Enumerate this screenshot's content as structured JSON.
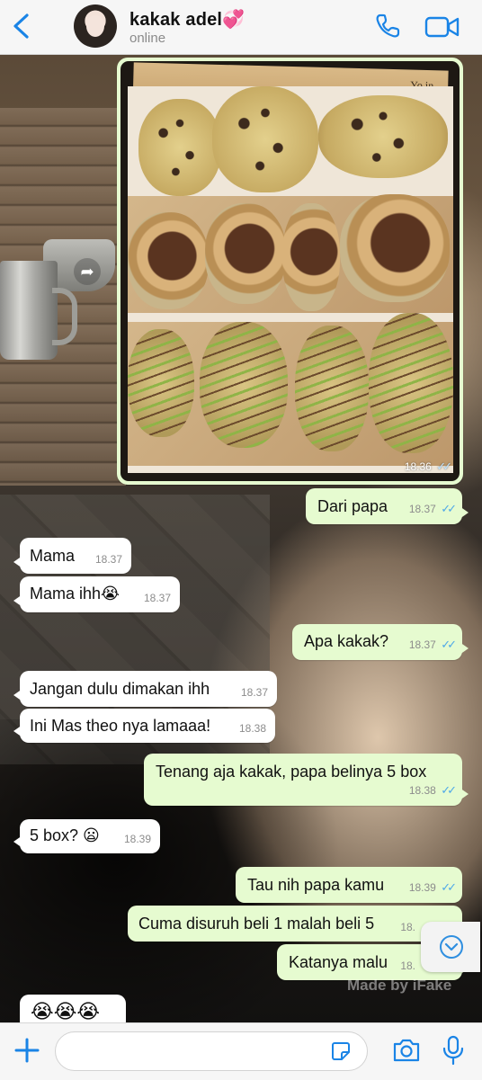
{
  "header": {
    "contact_name": "kakak adel💞",
    "status": "online",
    "back_icon": "chevron-left-icon",
    "call_icon": "phone-icon",
    "video_icon": "video-camera-icon",
    "accent_color": "#1a84e6"
  },
  "photo_message": {
    "time": "18.36",
    "newspaper_text": "Yo in"
  },
  "messages": [
    {
      "text": "Dari papa",
      "time": "18.37",
      "direction": "outgoing"
    },
    {
      "text": "Mama",
      "time": "18.37",
      "direction": "incoming"
    },
    {
      "text": "Mama ihh😭",
      "time": "18.37",
      "direction": "incoming"
    },
    {
      "text": "Apa kakak?",
      "time": "18.37",
      "direction": "outgoing"
    },
    {
      "text": "Jangan dulu dimakan ihh",
      "time": "18.37",
      "direction": "incoming"
    },
    {
      "text": "Ini Mas theo nya lamaaa!",
      "time": "18.38",
      "direction": "incoming"
    },
    {
      "text": "Tenang aja kakak, papa belinya 5 box",
      "time": "18.38",
      "direction": "outgoing"
    },
    {
      "text": "5 box? 😦",
      "time": "18.39",
      "direction": "incoming"
    },
    {
      "text": "Tau nih papa kamu",
      "time": "18.39",
      "direction": "outgoing"
    },
    {
      "text": "Cuma disuruh beli 1 malah beli 5",
      "time": "18.",
      "direction": "outgoing"
    },
    {
      "text": "Katanya malu",
      "time": "18.",
      "direction": "outgoing"
    },
    {
      "text": "😭😭😭",
      "time": "",
      "direction": "incoming"
    }
  ],
  "watermark": "Made by iFake",
  "input_bar": {
    "plus_icon": "plus-icon",
    "sticker_icon": "sticker-icon",
    "camera_icon": "camera-icon",
    "mic_icon": "microphone-icon",
    "message_value": ""
  },
  "colors": {
    "outgoing_bubble": "#e6fbd0",
    "incoming_bubble": "#ffffff",
    "read_ticks": "#4fa9e8",
    "bar_background": "#f6f6f6"
  }
}
